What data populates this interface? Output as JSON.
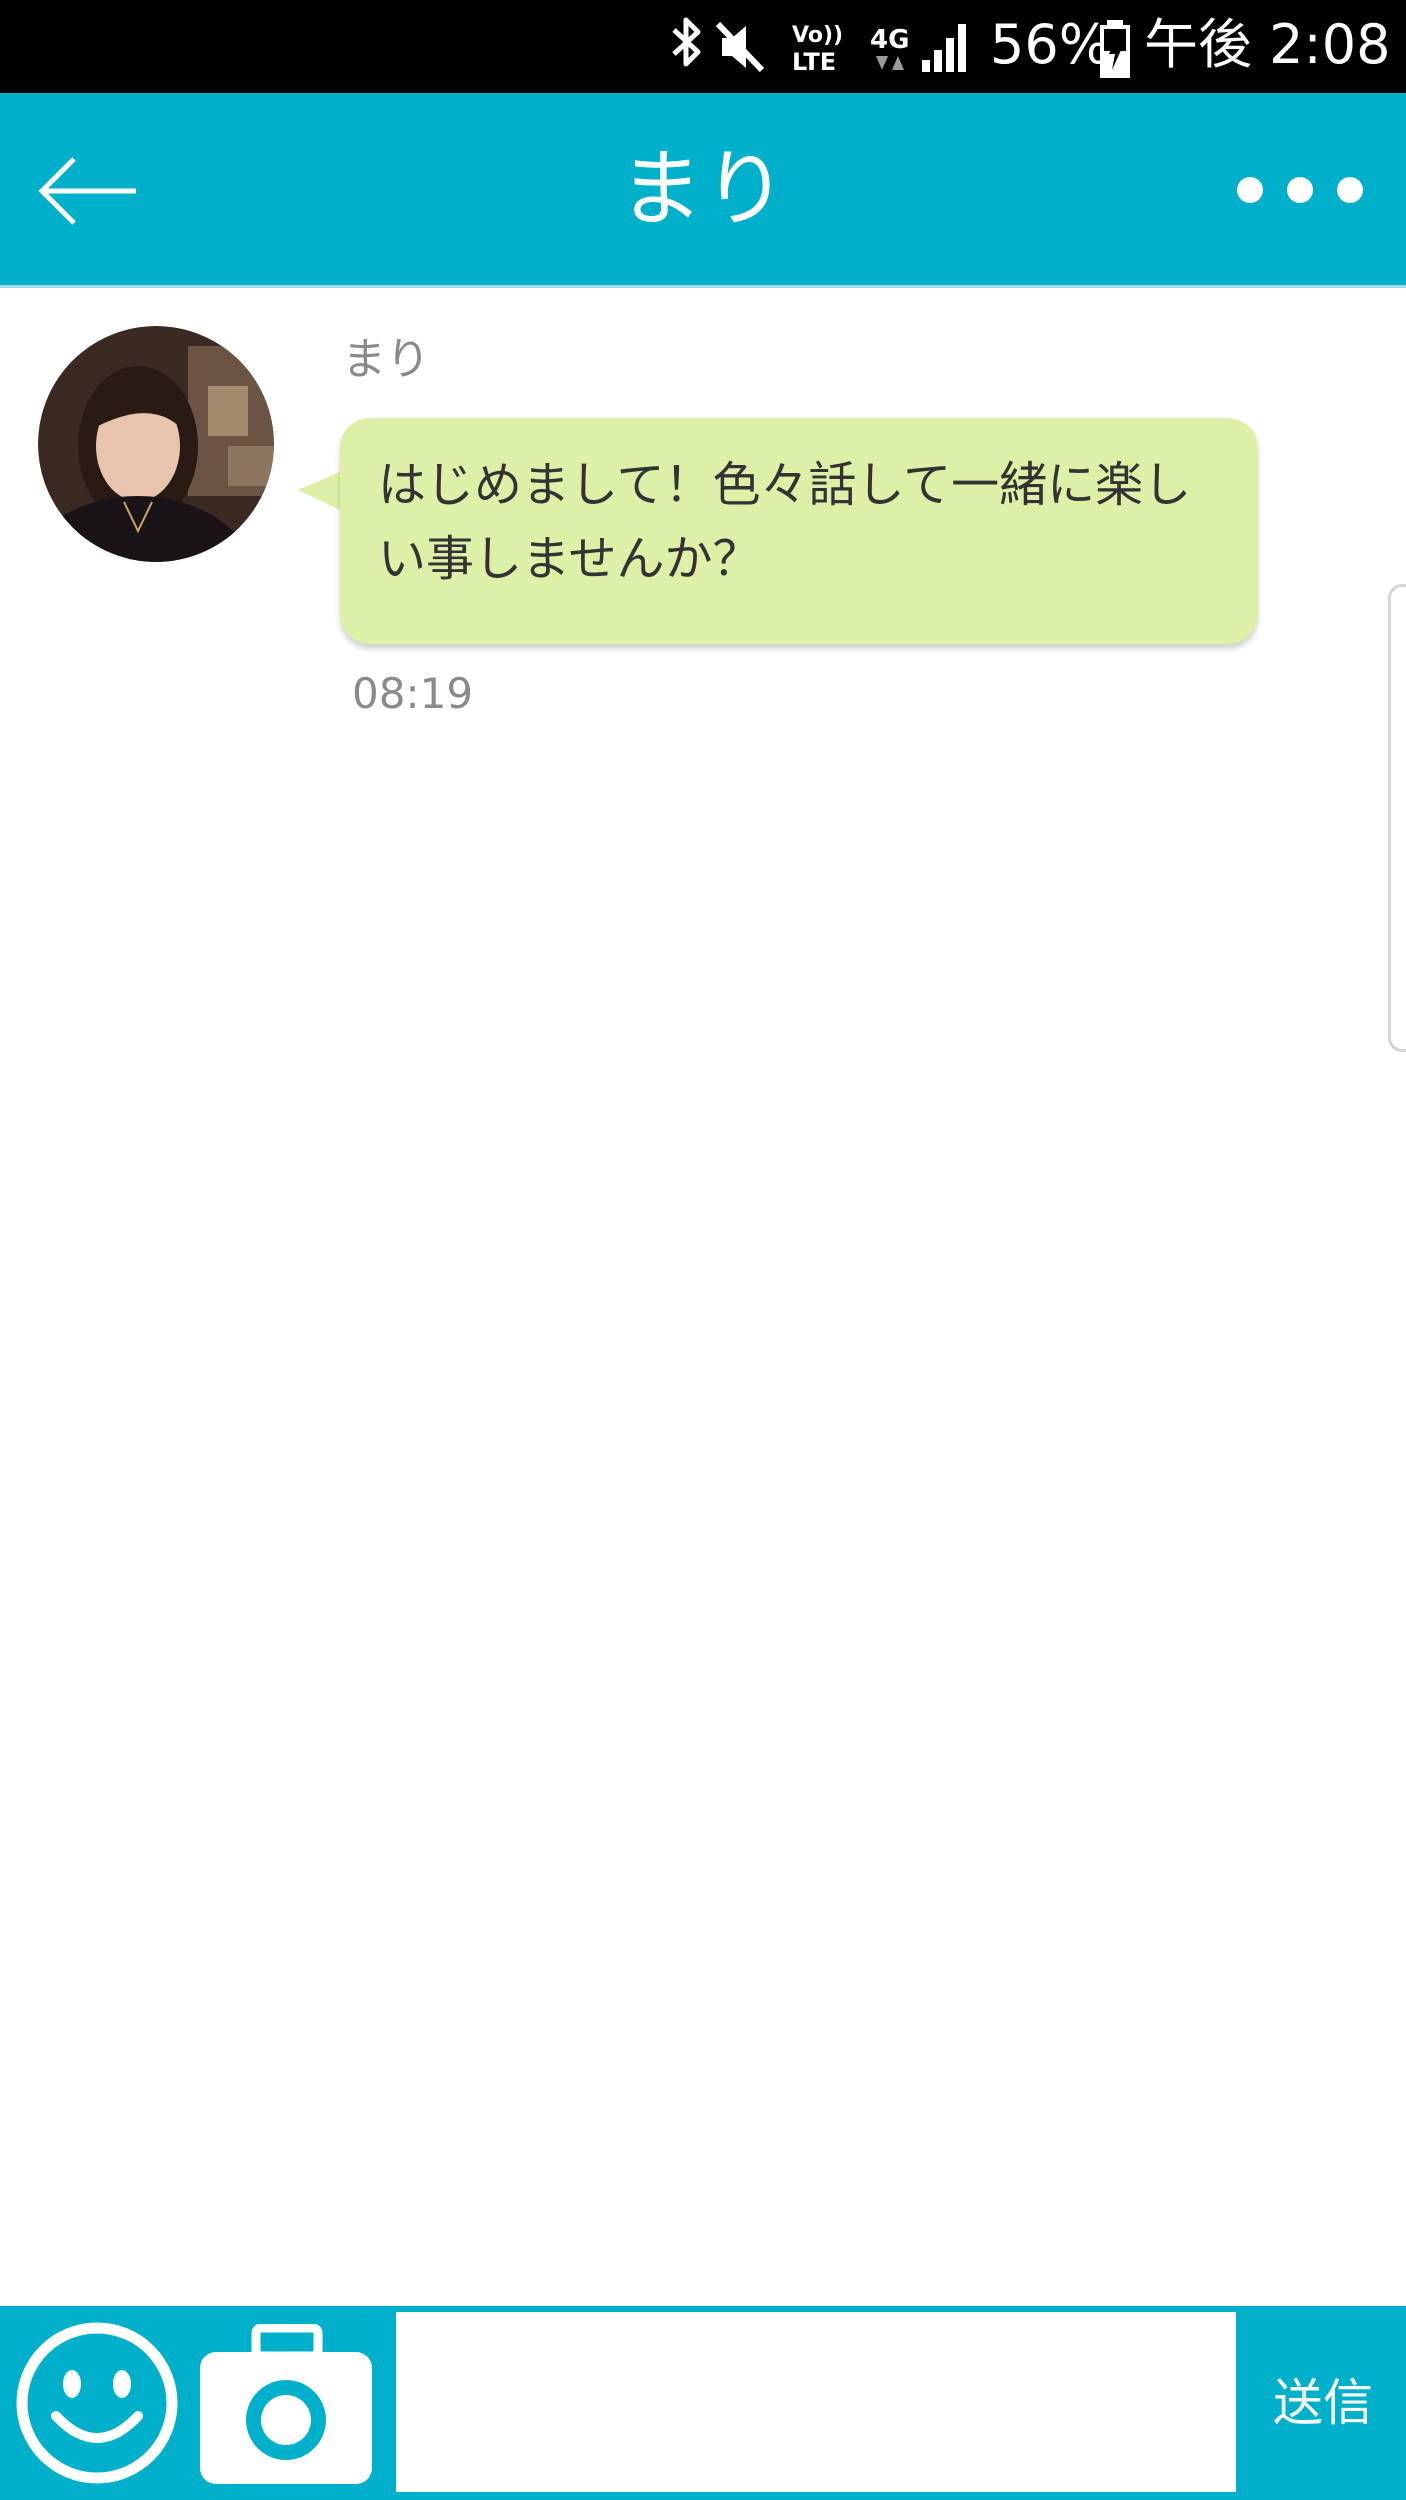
{
  "status_bar": {
    "icons": [
      "bluetooth-icon",
      "mute-icon",
      "volte-icon",
      "4g-data-icon",
      "signal-icon",
      "battery-charging-icon"
    ],
    "volte_label": "Vo)) LTE",
    "network_label": "4G",
    "battery_percent": "56%",
    "time": "午後 2:08"
  },
  "header": {
    "back_icon": "arrow-left-icon",
    "title": "まり",
    "more_icon": "more-dots-icon",
    "background_color": "#00b0cb"
  },
  "chat": {
    "messages": [
      {
        "sender": "まり",
        "avatar": "avatar-photo",
        "text": "はじめまして！色々話して一緒に楽しい事しませんか？",
        "time": "08:19",
        "bubble_color": "#ddf0a8"
      }
    ]
  },
  "composer": {
    "emoji_icon": "smiley-icon",
    "camera_icon": "camera-icon",
    "input_value": "",
    "input_placeholder": "",
    "send_label": "送信"
  }
}
